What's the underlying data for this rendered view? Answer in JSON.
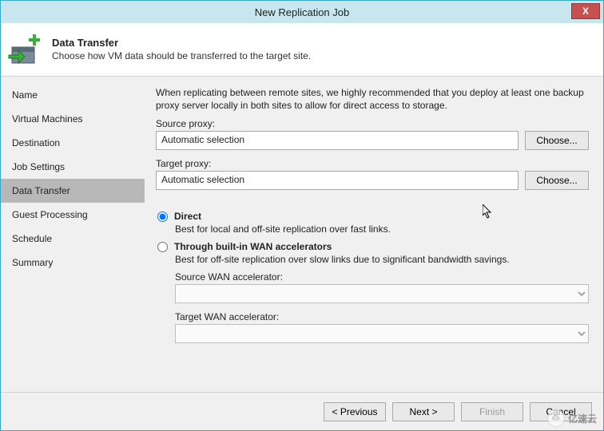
{
  "window": {
    "title": "New Replication Job",
    "close": "X"
  },
  "header": {
    "title": "Data Transfer",
    "subtitle": "Choose how VM data should be transferred to the target site."
  },
  "sidebar": {
    "items": [
      {
        "label": "Name"
      },
      {
        "label": "Virtual Machines"
      },
      {
        "label": "Destination"
      },
      {
        "label": "Job Settings"
      },
      {
        "label": "Data Transfer",
        "selected": true
      },
      {
        "label": "Guest Processing"
      },
      {
        "label": "Schedule"
      },
      {
        "label": "Summary"
      }
    ]
  },
  "content": {
    "intro": "When replicating between remote sites, we highly recommended that you deploy at least one backup proxy server locally in both sites to allow for direct access to storage.",
    "source_proxy_label": "Source proxy:",
    "source_proxy_value": "Automatic selection",
    "source_choose": "Choose...",
    "target_proxy_label": "Target proxy:",
    "target_proxy_value": "Automatic selection",
    "target_choose": "Choose...",
    "radio_direct": "Direct",
    "radio_direct_desc": "Best for local and off-site replication over fast links.",
    "radio_wan": "Through built-in WAN accelerators",
    "radio_wan_desc": "Best for off-site replication over slow links due to significant bandwidth savings.",
    "source_wan_label": "Source WAN accelerator:",
    "target_wan_label": "Target WAN accelerator:"
  },
  "footer": {
    "previous": "< Previous",
    "next": "Next >",
    "finish": "Finish",
    "cancel": "Cancel"
  },
  "watermark": "亿速云"
}
